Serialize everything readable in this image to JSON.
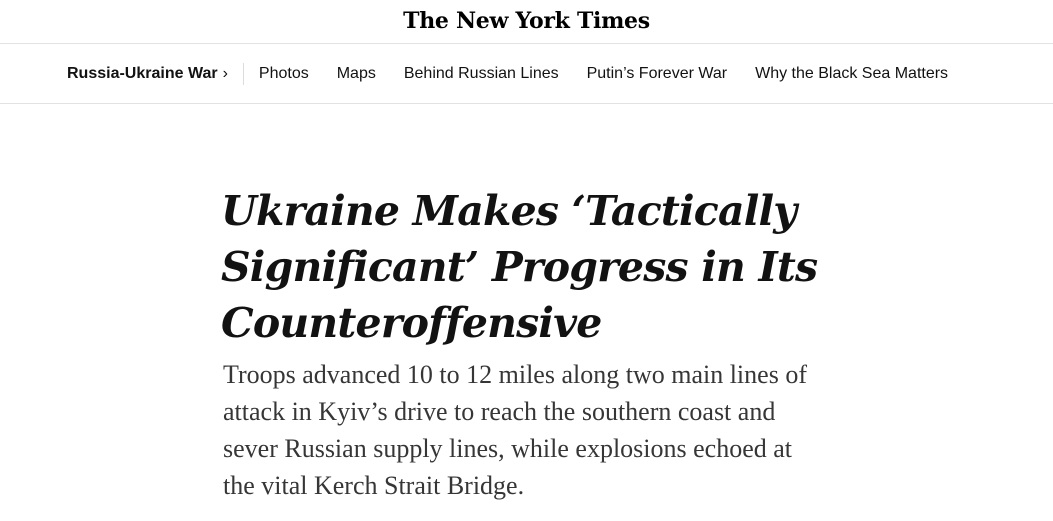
{
  "masthead": {
    "logo_text": "The New York Times"
  },
  "nav": {
    "section_label": "Russia-Ukraine War",
    "section_chevron": "›",
    "links": [
      {
        "label": "Photos"
      },
      {
        "label": "Maps"
      },
      {
        "label": "Behind Russian Lines"
      },
      {
        "label": "Putin’s Forever War"
      },
      {
        "label": "Why the Black Sea Matters"
      }
    ]
  },
  "article": {
    "headline": "Ukraine Makes ‘Tactically Significant’ Progress in Its Counteroffensive",
    "summary": "Troops advanced 10 to 12 miles along two main lines of attack in Kyiv’s drive to reach the southern coast and sever Russian supply lines, while explosions echoed at the vital Kerch Strait Bridge."
  }
}
